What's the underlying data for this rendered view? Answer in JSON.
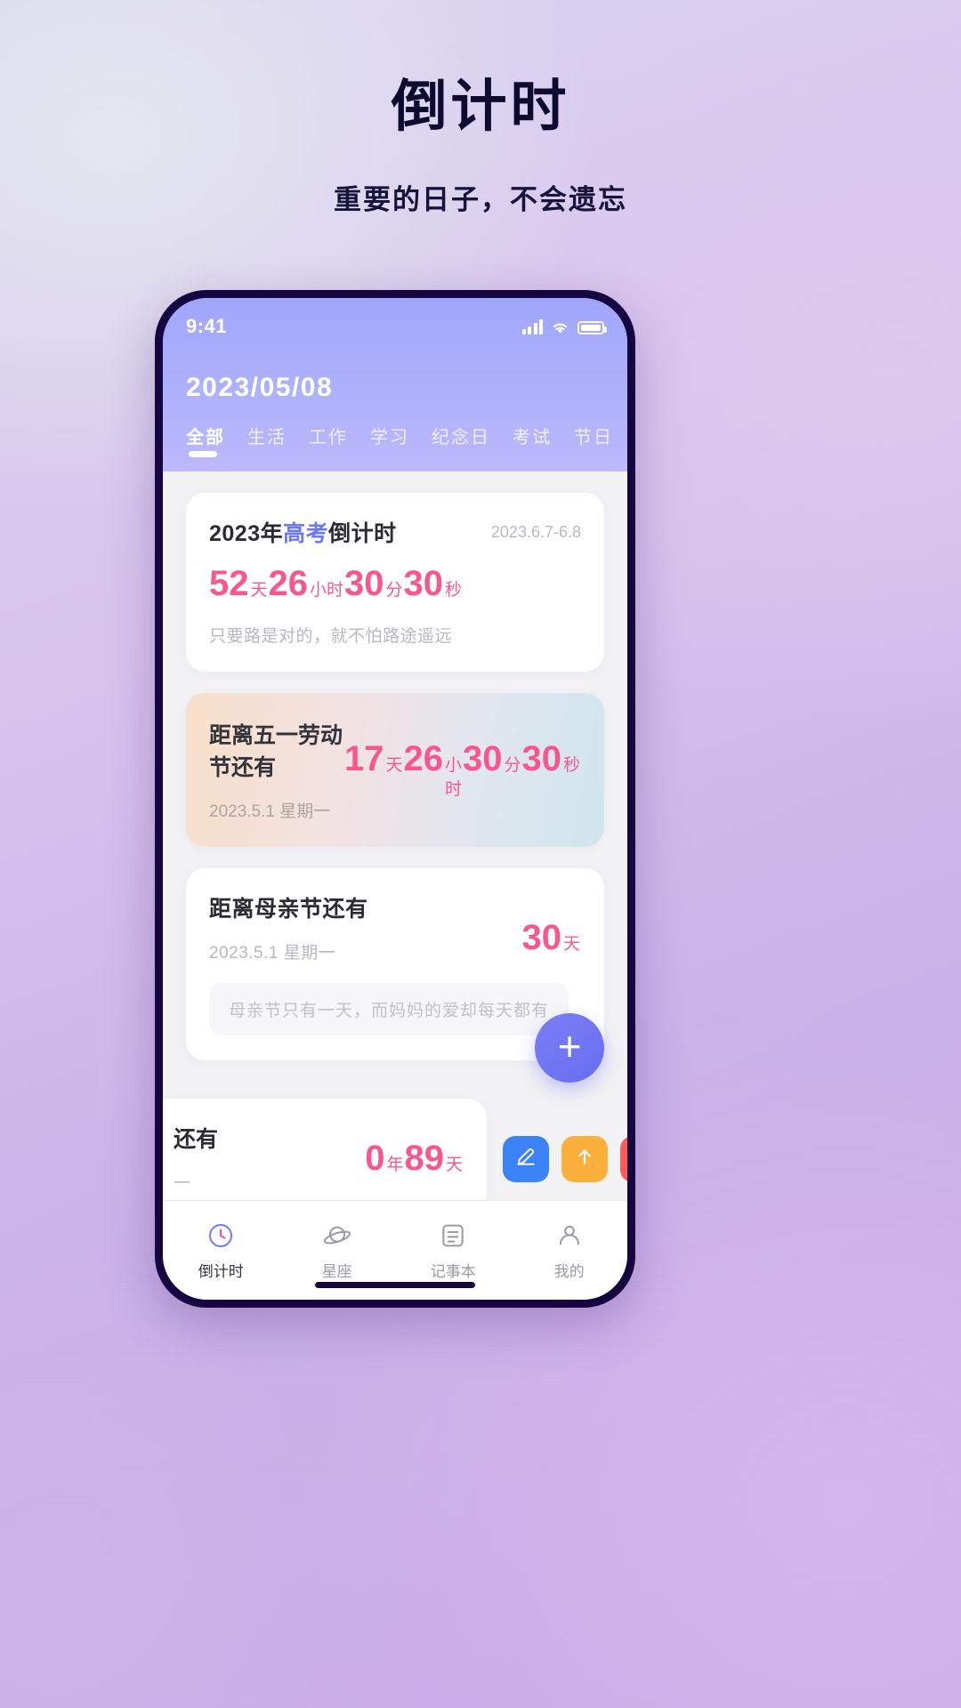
{
  "promo": {
    "title": "倒计时",
    "subtitle": "重要的日子，不会遗忘"
  },
  "statusbar": {
    "time": "9:41",
    "signal_icon": "cellular-signal-icon",
    "wifi_icon": "wifi-icon",
    "battery_icon": "battery-icon"
  },
  "header": {
    "date": "2023/05/08",
    "tabs": [
      {
        "label": "全部",
        "active": true
      },
      {
        "label": "生活",
        "active": false
      },
      {
        "label": "工作",
        "active": false
      },
      {
        "label": "学习",
        "active": false
      },
      {
        "label": "纪念日",
        "active": false
      },
      {
        "label": "考试",
        "active": false
      },
      {
        "label": "节日",
        "active": false
      }
    ]
  },
  "cards": {
    "gaokao": {
      "title_pre": "2023年",
      "title_hl": "高考",
      "title_post": "倒计时",
      "date_right": "2023.6.7-6.8",
      "count": {
        "days": "52",
        "days_unit": "天",
        "hours": "26",
        "hours_unit": "小时",
        "minutes": "30",
        "minutes_unit": "分",
        "seconds": "30",
        "seconds_unit": "秒"
      },
      "note": "只要路是对的，就不怕路途遥远"
    },
    "labor": {
      "title": "距离五一劳动节还有",
      "subtitle": "2023.5.1 星期一",
      "count": {
        "days": "17",
        "days_unit": "天",
        "hours": "26",
        "hours_unit": "小时",
        "minutes": "30",
        "minutes_unit": "分",
        "seconds": "30",
        "seconds_unit": "秒"
      }
    },
    "mothers": {
      "title": "距离母亲节还有",
      "subtitle": "2023.5.1 星期一",
      "value": "30",
      "value_unit": "天",
      "note": "母亲节只有一天，而妈妈的爱却每天都有"
    },
    "swiped": {
      "title": "还有",
      "subtitle": "一",
      "years": "0",
      "years_unit": "年",
      "days": "89",
      "days_unit": "天",
      "actions": [
        {
          "name": "edit",
          "icon": "edit-icon",
          "color": "#3b82f6"
        },
        {
          "name": "top",
          "icon": "pin-to-top-icon",
          "color": "#fbb03b"
        },
        {
          "name": "delete",
          "icon": "trash-icon",
          "color": "#ff5a5a"
        }
      ]
    }
  },
  "fab": {
    "label": "+",
    "icon": "plus-icon"
  },
  "nav": [
    {
      "label": "倒计时",
      "icon": "clock-icon",
      "active": true
    },
    {
      "label": "星座",
      "icon": "planet-icon",
      "active": false
    },
    {
      "label": "记事本",
      "icon": "notebook-icon",
      "active": false
    },
    {
      "label": "我的",
      "icon": "person-icon",
      "active": false
    }
  ],
  "colors": {
    "accent_pink": "#f8578e",
    "accent_blue": "#6c78ef",
    "header_gradient_start": "#a0a6fb",
    "header_gradient_end": "#bdb8fa"
  }
}
